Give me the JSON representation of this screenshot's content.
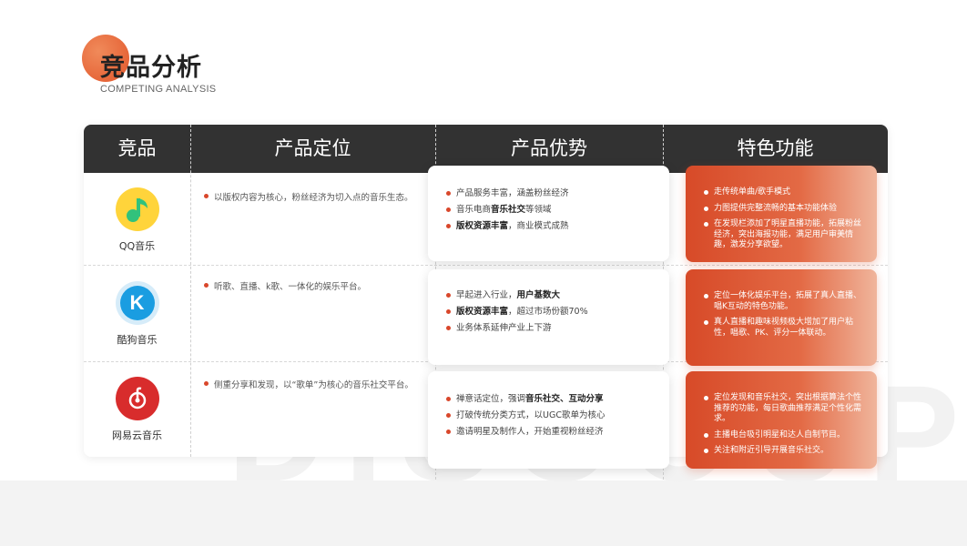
{
  "header": {
    "title": "竞品分析",
    "subtitle": "COMPETING ANALYSIS"
  },
  "table": {
    "columns": [
      "竞品",
      "产品定位",
      "产品优势",
      "特色功能"
    ],
    "rows": [
      {
        "product": "QQ音乐",
        "icon": "qq-music-icon",
        "positioning": "以版权内容为核心，粉丝经济为切入点的音乐生态。",
        "advantages": [
          [
            {
              "t": "产品服务丰富，涵盖粉丝经济",
              "b": false
            }
          ],
          [
            {
              "t": "音乐电商",
              "b": false
            },
            {
              "t": "音乐社交",
              "b": true
            },
            {
              "t": "等领域",
              "b": false
            }
          ],
          [
            {
              "t": "版权资源丰富",
              "b": true
            },
            {
              "t": "，商业模式成熟",
              "b": false
            }
          ]
        ],
        "features": [
          "走传统单曲/歌手模式",
          "力图提供完整流畅的基本功能体验",
          "在发现栏添加了明星直播功能，拓展粉丝经济，突出海报功能，满足用户审美情趣，激发分享欲望。"
        ]
      },
      {
        "product": "酷狗音乐",
        "icon": "kugou-music-icon",
        "positioning": "听歌、直播、k歌、一体化的娱乐平台。",
        "advantages": [
          [
            {
              "t": "早起进入行业，",
              "b": false
            },
            {
              "t": "用户基数大",
              "b": true
            }
          ],
          [
            {
              "t": "版权资源丰富",
              "b": true
            },
            {
              "t": "，超过市场份额70%",
              "b": false
            }
          ],
          [
            {
              "t": "业务体系延伸产业上下游",
              "b": false
            }
          ]
        ],
        "features": [
          "定位一体化娱乐平台，拓展了真人直播、唱K互动的特色功能。",
          "真人直播和趣味视频极大增加了用户粘性，唱歌、PK、评分一体联动。"
        ]
      },
      {
        "product": "网易云音乐",
        "icon": "netease-cloud-music-icon",
        "positioning": "侧重分享和发现，以“歌单”为核心的音乐社交平台。",
        "advantages": [
          [
            {
              "t": "禅意话定位，强调",
              "b": false
            },
            {
              "t": "音乐社交、互动分享",
              "b": true
            }
          ],
          [
            {
              "t": "打破传统分类方式，以UGC歌单为核心",
              "b": false
            }
          ],
          [
            {
              "t": "邀请明星及制作人，开始重视粉丝经济",
              "b": false
            }
          ]
        ],
        "features": [
          "定位发现和音乐社交，突出根据算法个性推荐的功能，每日歌曲推荐满足个性化需求。",
          "主播电台吸引明星和达人自制节目。",
          "关注和附近引导开展音乐社交。"
        ]
      }
    ]
  },
  "colors": {
    "accent": "#d9472b",
    "header_bg": "#323232",
    "qq_green": "#31c27c",
    "qq_yellow": "#ffd43b",
    "kugou_blue": "#1a9de1",
    "netease_red": "#d82c2c"
  }
}
